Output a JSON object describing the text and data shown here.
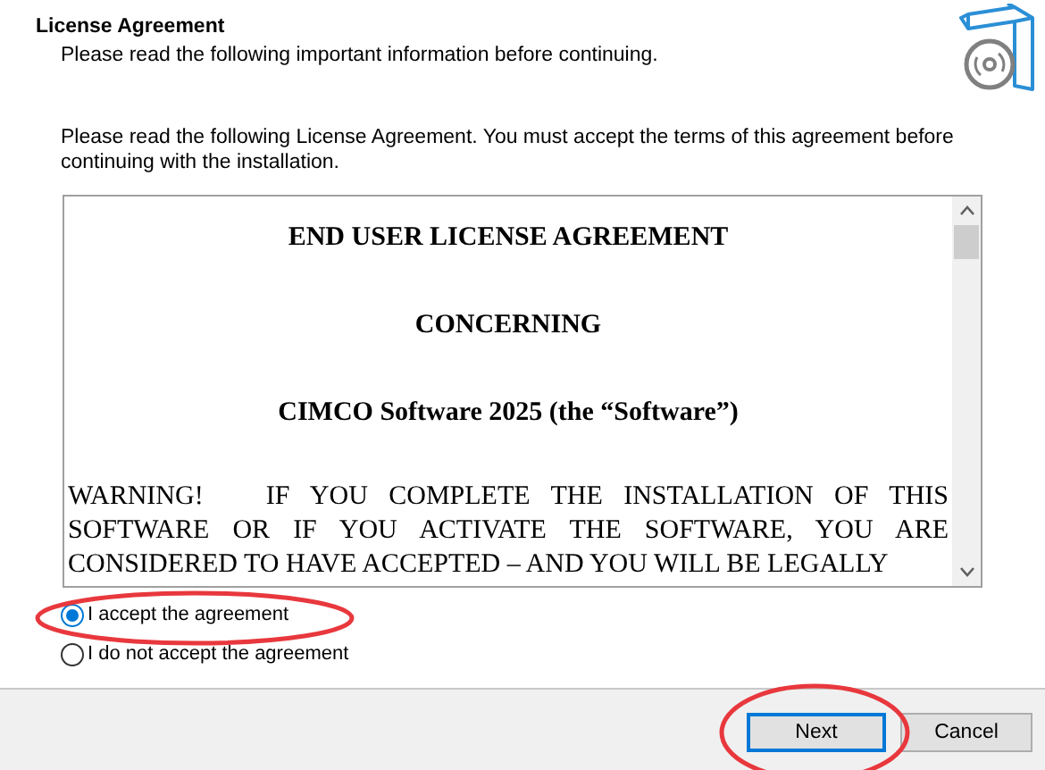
{
  "header": {
    "title": "License Agreement",
    "subtitle": "Please read the following important information before continuing."
  },
  "intro": "Please read the following License Agreement. You must accept the terms of this agreement before continuing with the installation.",
  "license_text": [
    {
      "kind": "heading",
      "text": "END USER LICENSE AGREEMENT"
    },
    {
      "kind": "heading",
      "text": "CONCERNING"
    },
    {
      "kind": "heading",
      "text": "CIMCO Software 2025 (the “Software”)"
    },
    {
      "kind": "paragraph",
      "text": "WARNING!   IF YOU COMPLETE THE INSTALLATION OF THIS SOFTWARE OR IF YOU ACTIVATE THE SOFTWARE, YOU ARE CONSIDERED TO HAVE ACCEPTED – AND YOU WILL BE LEGALLY"
    }
  ],
  "options": [
    {
      "label": "I accept the agreement",
      "selected": true
    },
    {
      "label": "I do not accept the agreement",
      "selected": false
    }
  ],
  "buttons": [
    {
      "label": "Next",
      "focused": true
    },
    {
      "label": "Cancel",
      "focused": false
    }
  ]
}
